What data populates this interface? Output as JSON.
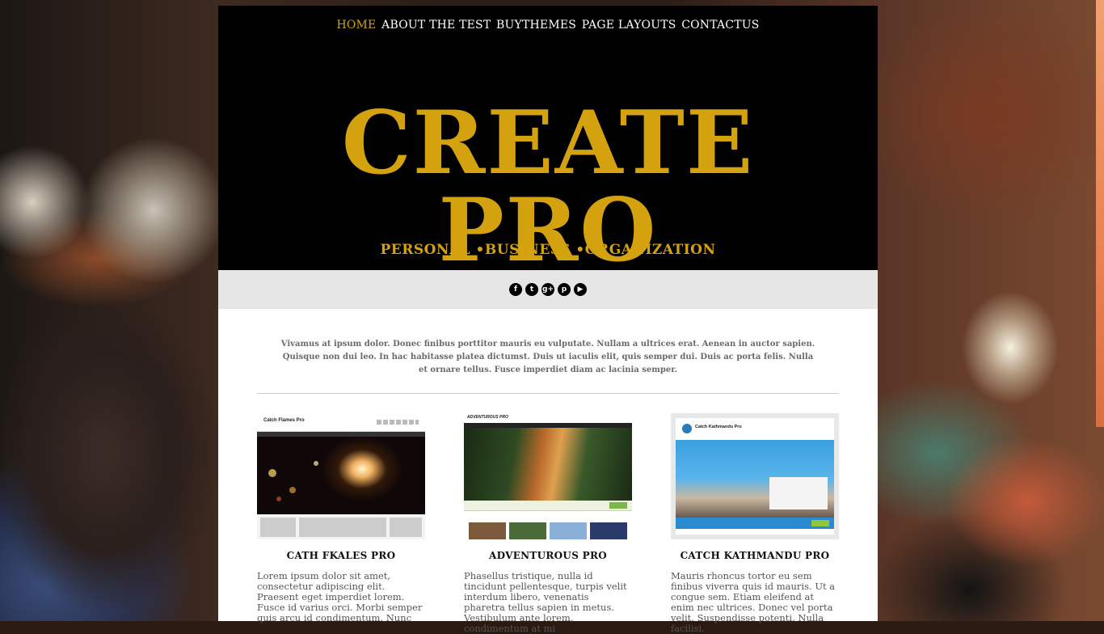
{
  "nav": {
    "items": [
      "HOME",
      "ABOUT THE TEST",
      "BUYTHEMES",
      "PAGE LAYOUTS",
      "CONTACTUS"
    ]
  },
  "site": {
    "title": "CREATE PRO",
    "tagline": "PERSONAL •BUSINESS •ORGANIZATION",
    "accent_color": "#d4a20f"
  },
  "social": {
    "icons": [
      "facebook-icon",
      "twitter-icon",
      "google-plus-icon",
      "pinterest-icon",
      "youtube-icon"
    ],
    "glyphs": [
      "f",
      "t",
      "g+",
      "p",
      "▶"
    ]
  },
  "intro": {
    "text": "Vivamus at ipsum dolor. Donec finibus porttitor mauris eu vulputate. Nullam a ultrices erat. Aenean in auctor sapien. Quisque non dui leo. In hac habitasse platea dictumst. Duis ut iaculis elit, quis semper dui. Duis ac porta felis. Nulla et ornare tellus. Fusce imperdiet diam ac lacinia semper."
  },
  "cards": [
    {
      "thumb_label": "Catch Flames Pro",
      "title": "CATH FKALES PRO",
      "text": "Lorem ipsum dolor sit amet, consectetur adipiscing elit. Praesent eget imperdiet lorem. Fusce id varius orci. Morbi semper quis arcu id condimentum. Nunc"
    },
    {
      "thumb_label": "ADVENTUROUS PRO",
      "title": "ADVENTUROUS PRO",
      "text": "Phasellus tristique, nulla id tincidunt pellentesque, turpis velit interdum libero, venenatis pharetra tellus sapien in metus. Vestibulum ante lorem, condimentum at mi"
    },
    {
      "thumb_label": "Catch Kathmandu Pro",
      "title": "CATCH KATHMANDU PRO",
      "text": "Mauris rhoncus tortor eu sem finibus viverra quis id mauris. Ut a congue sem. Etiam eleifend at enim nec ultrices. Donec vel porta velit. Suspendisse potenti. Nulla facilisi."
    }
  ]
}
